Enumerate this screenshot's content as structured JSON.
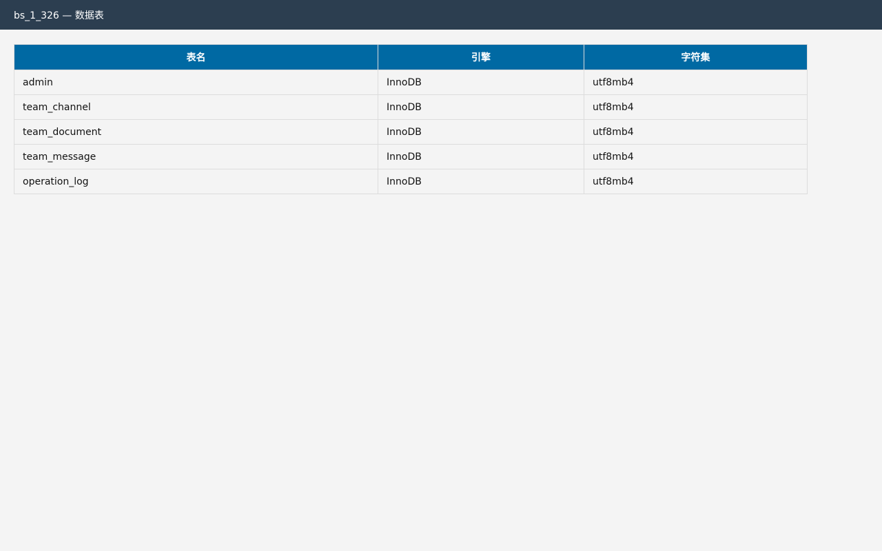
{
  "header": {
    "title": "bs_1_326 — 数据表"
  },
  "table": {
    "columns": [
      "表名",
      "引擎",
      "字符集"
    ],
    "rows": [
      [
        "admin",
        "InnoDB",
        "utf8mb4"
      ],
      [
        "team_channel",
        "InnoDB",
        "utf8mb4"
      ],
      [
        "team_document",
        "InnoDB",
        "utf8mb4"
      ],
      [
        "team_message",
        "InnoDB",
        "utf8mb4"
      ],
      [
        "operation_log",
        "InnoDB",
        "utf8mb4"
      ]
    ]
  },
  "colors": {
    "topbar": "#2c3e50",
    "table_header": "#0069a3",
    "page_background": "#f4f4f4"
  }
}
